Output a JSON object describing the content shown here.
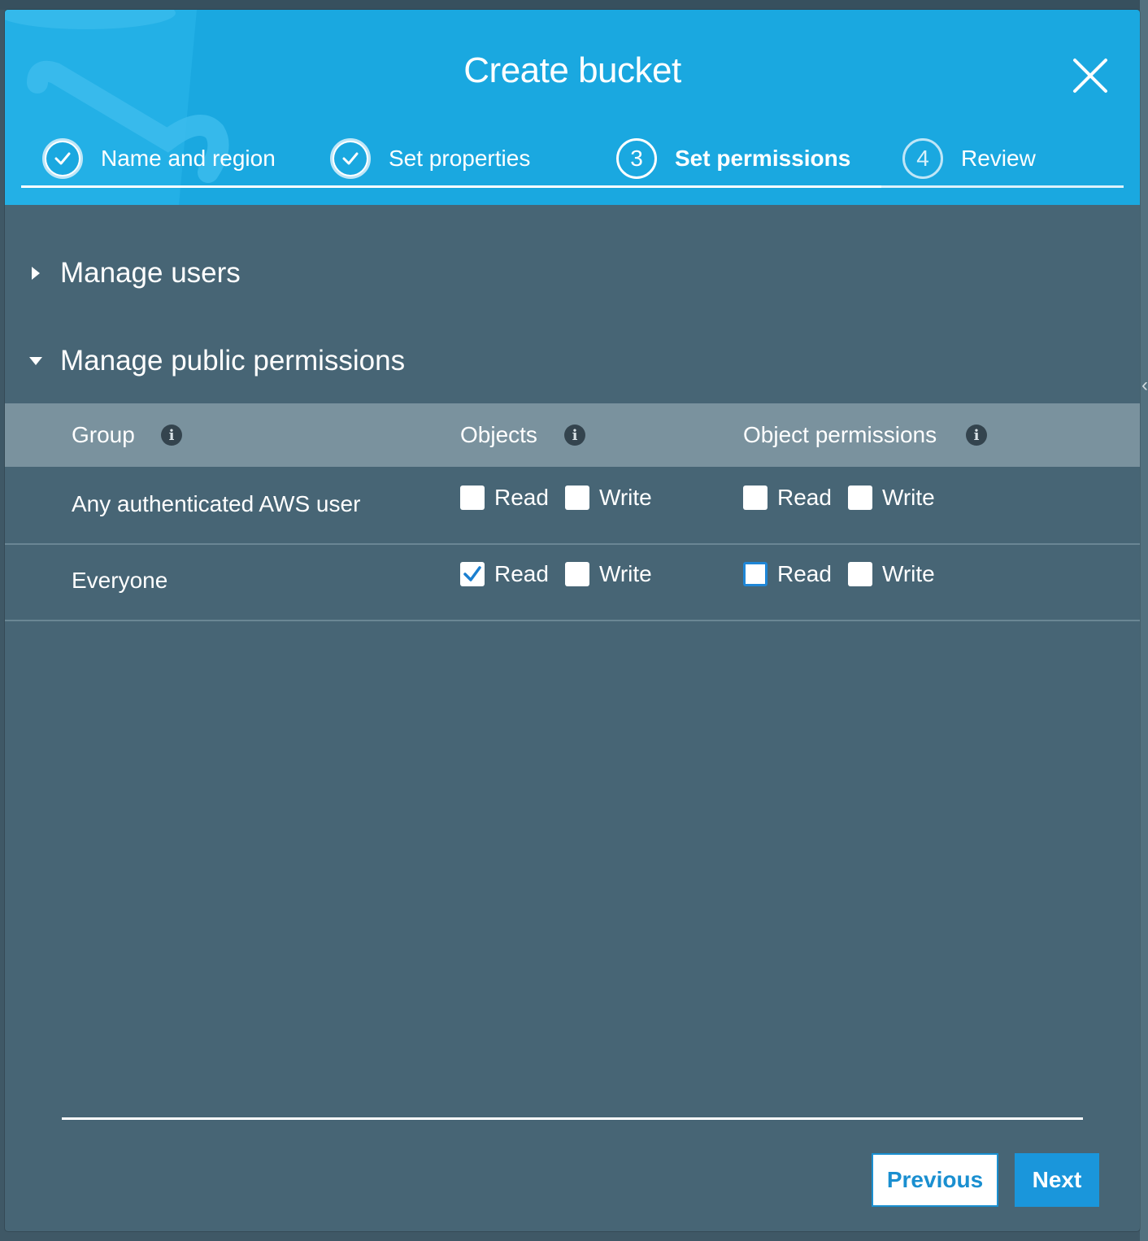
{
  "dialog": {
    "title": "Create bucket",
    "close_icon": "close-icon"
  },
  "steps": [
    {
      "label": "Name and region",
      "status": "done",
      "icon": "check-icon"
    },
    {
      "label": "Set properties",
      "status": "done",
      "icon": "check-icon"
    },
    {
      "label": "Set permissions",
      "status": "active",
      "number": "3"
    },
    {
      "label": "Review",
      "status": "pending",
      "number": "4"
    }
  ],
  "sections": {
    "manage_users": {
      "label": "Manage users",
      "expanded": false
    },
    "manage_public": {
      "label": "Manage public permissions",
      "expanded": true
    }
  },
  "table": {
    "headers": {
      "group": "Group",
      "objects": "Objects",
      "object_permissions": "Object permissions"
    },
    "info_glyph": "i",
    "rows": [
      {
        "group": "Any authenticated AWS user",
        "objects": {
          "read_label": "Read",
          "read": false,
          "write_label": "Write",
          "write": false
        },
        "object_permissions": {
          "read_label": "Read",
          "read": false,
          "write_label": "Write",
          "write": false
        }
      },
      {
        "group": "Everyone",
        "objects": {
          "read_label": "Read",
          "read": true,
          "write_label": "Write",
          "write": false
        },
        "object_permissions": {
          "read_label": "Read",
          "read": false,
          "write_label": "Write",
          "write": false
        }
      }
    ]
  },
  "footer": {
    "previous_label": "Previous",
    "next_label": "Next"
  },
  "colors": {
    "header": "#1aa8e0",
    "body": "#476575",
    "table_head": "#7a929e",
    "primary_button": "#1a96db"
  }
}
